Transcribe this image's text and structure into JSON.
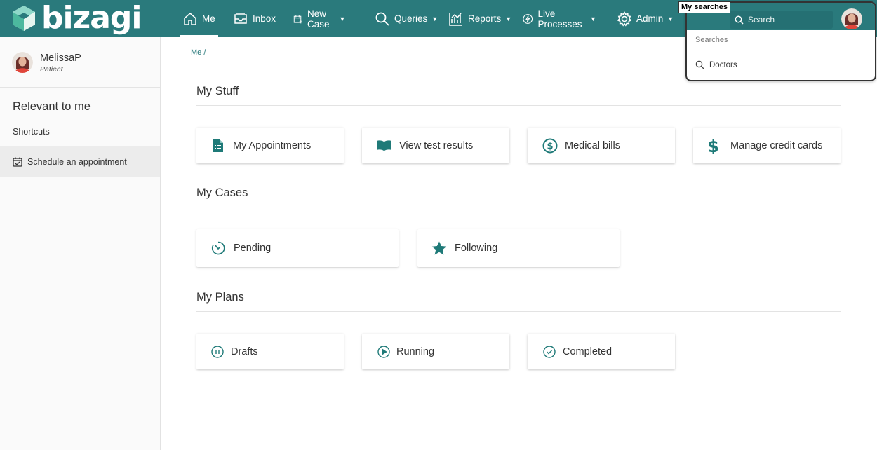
{
  "app": {
    "brand": "bizagi"
  },
  "nav": {
    "items": [
      {
        "label": "Me",
        "icon": "home-icon",
        "active": true,
        "dropdown": false
      },
      {
        "label": "Inbox",
        "icon": "inbox-icon",
        "active": false,
        "dropdown": false
      },
      {
        "label": "New Case",
        "icon": "new-case-icon",
        "active": false,
        "dropdown": true
      },
      {
        "label": "Queries",
        "icon": "search-icon",
        "active": false,
        "dropdown": true
      },
      {
        "label": "Reports",
        "icon": "reports-chart-icon",
        "active": false,
        "dropdown": true
      },
      {
        "label": "Live Processes",
        "icon": "lightning-icon",
        "active": false,
        "dropdown": true
      },
      {
        "label": "Admin",
        "icon": "gear-icon",
        "active": false,
        "dropdown": true
      }
    ]
  },
  "search": {
    "tooltip": "My searches",
    "placeholder": "Search",
    "section_label": "Searches",
    "results": [
      {
        "label": "Doctors",
        "icon": "search-icon"
      }
    ]
  },
  "sidebar": {
    "user_name": "MelissaP",
    "user_role": "Patient",
    "relevant_heading": "Relevant to me",
    "shortcuts_label": "Shortcuts",
    "shortcut_items": [
      {
        "label": "Schedule an appointment",
        "icon": "calendar-check-icon"
      }
    ]
  },
  "breadcrumb": "Me /",
  "sections": {
    "my_stuff": {
      "title": "My Stuff",
      "cards": [
        {
          "label": "My Appointments",
          "icon": "document-list-icon"
        },
        {
          "label": "View test results",
          "icon": "open-book-icon"
        },
        {
          "label": "Medical bills",
          "icon": "dollar-circle-icon"
        },
        {
          "label": "Manage credit cards",
          "icon": "dollar-sign-icon"
        }
      ]
    },
    "my_cases": {
      "title": "My Cases",
      "cards": [
        {
          "label": "Pending",
          "icon": "clock-icon"
        },
        {
          "label": "Following",
          "icon": "star-icon"
        }
      ]
    },
    "my_plans": {
      "title": "My Plans",
      "cards": [
        {
          "label": "Drafts",
          "icon": "pause-circle-icon"
        },
        {
          "label": "Running",
          "icon": "play-circle-icon"
        },
        {
          "label": "Completed",
          "icon": "check-circle-icon"
        }
      ]
    }
  },
  "colors": {
    "brand": "#2a7a7c",
    "accent": "#1f7a78",
    "background": "#ffffff",
    "sidebar": "#fafafa"
  }
}
